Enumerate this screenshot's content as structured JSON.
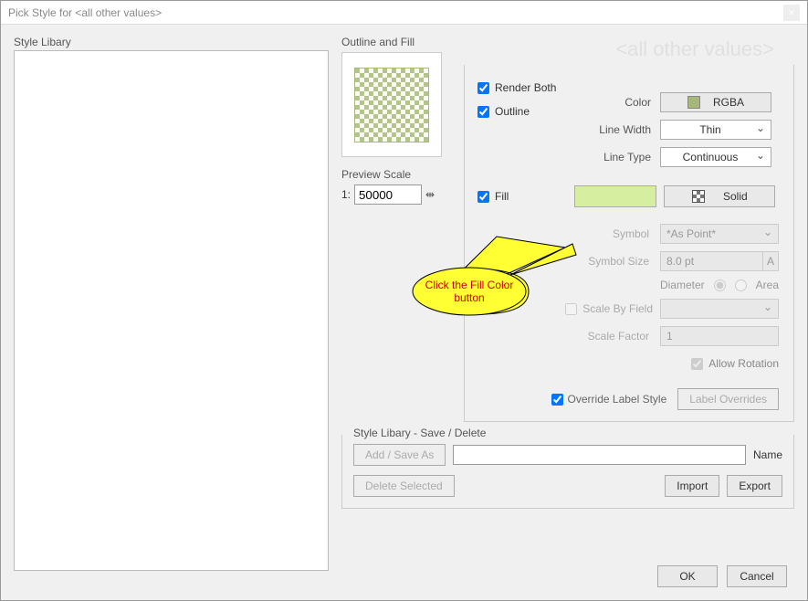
{
  "window": {
    "title": "Pick Style for <all other values>"
  },
  "watermark": "<all other values>",
  "library": {
    "label": "Style Libary"
  },
  "preview": {
    "outline_fill_label": "Outline and Fill",
    "scale_label": "Preview Scale",
    "scale_prefix": "1:",
    "scale_value": "50000"
  },
  "style": {
    "render_both": "Render Both",
    "outline": "Outline",
    "color_label": "Color",
    "color_button": "RGBA",
    "line_width_label": "Line Width",
    "line_width_value": "Thin",
    "line_type_label": "Line Type",
    "line_type_value": "Continuous",
    "fill_label": "Fill",
    "fill_pattern": "Solid",
    "symbol_label": "Symbol",
    "symbol_value": "*As Point*",
    "symbol_size_label": "Symbol Size",
    "symbol_size_value": "8.0 pt",
    "diameter_label": "Diameter",
    "area_label": "Area",
    "scale_by_field_label": "Scale By Field",
    "scale_factor_label": "Scale Factor",
    "scale_factor_value": "1",
    "allow_rotation": "Allow Rotation",
    "override_label_style": "Override Label Style",
    "label_overrides_btn": "Label Overrides"
  },
  "save": {
    "legend": "Style Libary - Save / Delete",
    "add_save_as": "Add / Save As",
    "name_label": "Name",
    "delete_selected": "Delete Selected",
    "import": "Import",
    "export": "Export"
  },
  "buttons": {
    "ok": "OK",
    "cancel": "Cancel"
  },
  "callout": {
    "line1": "Click the Fill Color",
    "line2": "button"
  },
  "symbol_size_suffix": "A"
}
